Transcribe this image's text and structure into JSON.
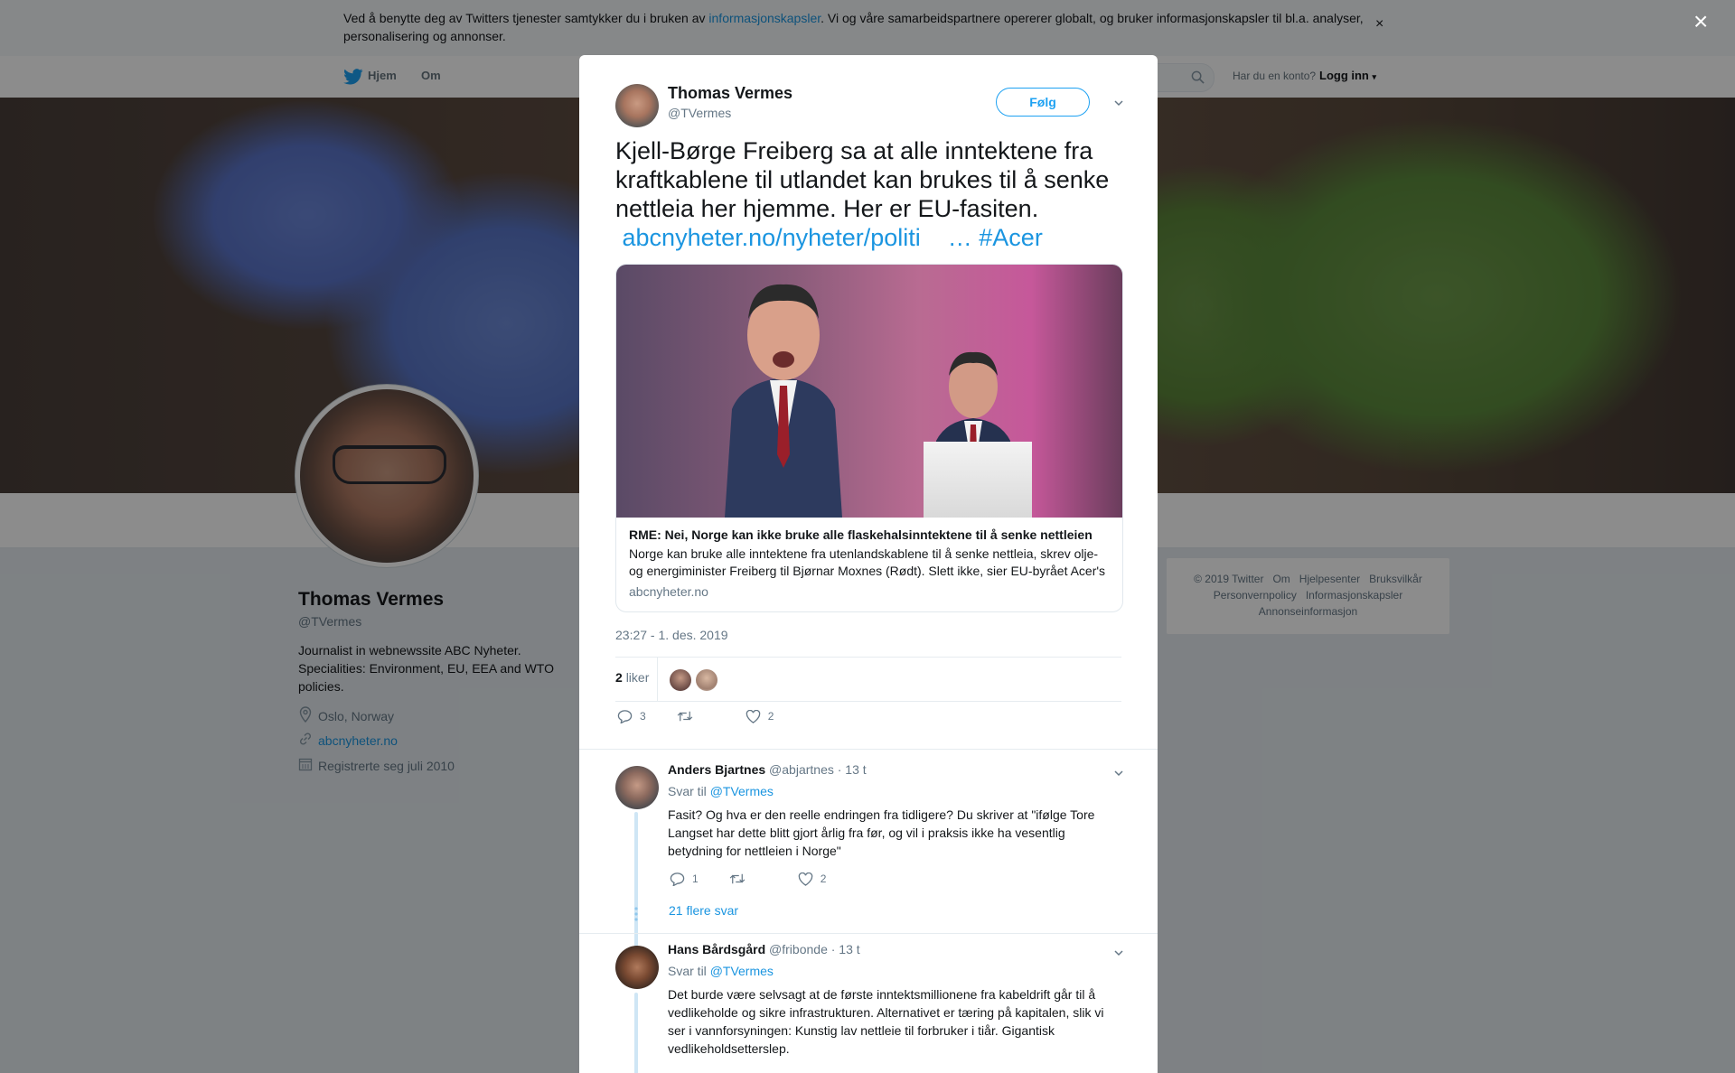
{
  "consent": {
    "text_before": "Ved å benytte deg av Twitters tjenester samtykker du i bruken av ",
    "link": "informasjonskapsler",
    "text_after": ". Vi og våre samarbeidspartnere opererer globalt, og bruker informasjonskapsler til bl.a. analyser, personalisering og annonser.",
    "close": "×"
  },
  "nav": {
    "home": "Hjem",
    "about": "Om",
    "have_account": "Har du en konto?",
    "login": "Logg inn"
  },
  "profile": {
    "name": "Thomas Vermes",
    "handle": "@TVermes",
    "bio": "Journalist in webnewssite ABC Nyheter. Specialities: Environment, EU, EEA and WTO policies.",
    "location": "Oslo, Norway",
    "website": "abcnyheter.no",
    "joined": "Registrerte seg juli 2010"
  },
  "footer": {
    "row1": [
      "© 2019 Twitter",
      "Om",
      "Hjelpesenter",
      "Bruksvilkår"
    ],
    "row2": [
      "Personvernpolicy",
      "Informasjonskapsler"
    ],
    "row3": [
      "Annonseinformasjon"
    ]
  },
  "overlay_close": "×",
  "tweet": {
    "author_name": "Thomas Vermes",
    "author_handle": "@TVermes",
    "follow_label": "Følg",
    "text": "Kjell-Børge Freiberg sa at alle inntektene fra kraftkablene til utlandet kan brukes til å senke nettleia her hjemme. Her er EU-fasiten.",
    "link_text": "abcnyheter.no/nyheter/politi",
    "link_ellipsis": "…",
    "hashtag": "#Acer",
    "card": {
      "title": "RME: Nei, Norge kan ikke bruke alle flaskehalsinntektene til å senke nettleien",
      "description": "Norge kan bruke alle inntektene fra utenlandskablene til å senke nettleia, skrev olje- og energiminister Freiberg til Bjørnar Moxnes (Rødt). Slett ikke, sier EU-byrået Acer's",
      "domain": "abcnyheter.no"
    },
    "timestamp": "23:27 - 1. des. 2019",
    "likes_count": "2",
    "likes_label": "liker",
    "reply_count": "3",
    "retweet_count": "",
    "like_count": "2"
  },
  "replies": [
    {
      "name": "Anders Bjartnes",
      "handle": "@abjartnes",
      "time": "· 13 t",
      "reply_to_label": "Svar til",
      "reply_to": "@TVermes",
      "text": "Fasit? Og hva er den reelle endringen fra tidligere? Du skriver at \"ifølge Tore Langset har dette blitt gjort årlig fra før, og vil i praksis ikke ha vesentlig betydning for nettleien i Norge\"",
      "reply_count": "1",
      "retweet_count": "",
      "like_count": "2",
      "more": "21 flere svar"
    },
    {
      "name": "Hans Bårdsgård",
      "handle": "@fribonde",
      "time": "· 13 t",
      "reply_to_label": "Svar til",
      "reply_to": "@TVermes",
      "text": "Det burde være selvsagt at de første inntektsmillionene fra kabeldrift går til å vedlikeholde og sikre infrastrukturen. Alternativet er tæring på kapitalen, slik vi ser i vannforsyningen: Kunstig lav nettleie til forbruker i tiår. Gigantisk vedlikeholdsetterslep."
    }
  ],
  "colors": {
    "link": "#1b95e0",
    "brand": "#1da1f2",
    "overlay": "rgba(0,0,0,0.45)"
  }
}
